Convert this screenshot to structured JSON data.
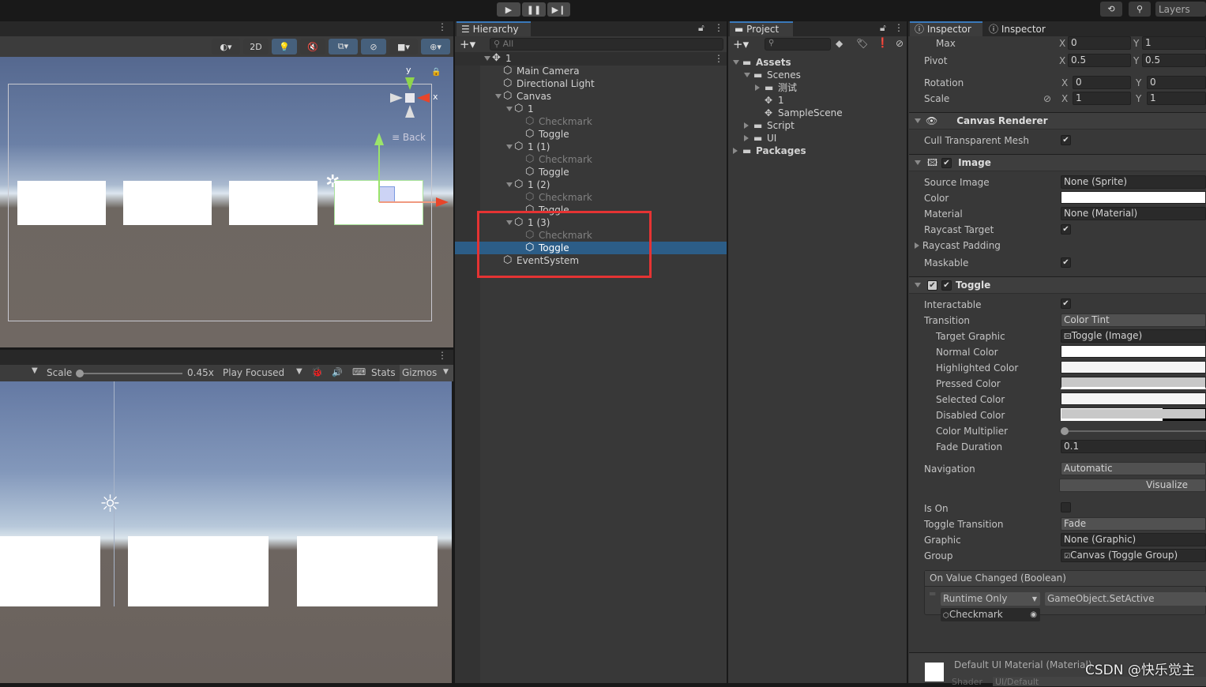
{
  "toolbar": {
    "play_icon": "play-icon",
    "pause_icon": "pause-icon",
    "step_icon": "step-icon",
    "layers": "Layers"
  },
  "scene": {
    "mode_2d": "2D",
    "gizmo_y": "y",
    "gizmo_x": "x",
    "view_label": "Back"
  },
  "game": {
    "scale_label": "Scale",
    "scale_value": "0.45x",
    "scale_fraction": 0.0,
    "play_mode": "Play Focused",
    "stats": "Stats",
    "gizmos": "Gizmos"
  },
  "hierarchy": {
    "title": "Hierarchy",
    "search_placeholder": "All",
    "rows": [
      {
        "text": "1",
        "depth": 0,
        "expanded": true,
        "scene": true
      },
      {
        "text": "Main Camera",
        "depth": 1
      },
      {
        "text": "Directional Light",
        "depth": 1
      },
      {
        "text": "Canvas",
        "depth": 1,
        "expanded": true
      },
      {
        "text": "1",
        "depth": 2,
        "expanded": true
      },
      {
        "text": "Checkmark",
        "depth": 3,
        "dim": true
      },
      {
        "text": "Toggle",
        "depth": 3
      },
      {
        "text": "1 (1)",
        "depth": 2,
        "expanded": true
      },
      {
        "text": "Checkmark",
        "depth": 3,
        "dim": true
      },
      {
        "text": "Toggle",
        "depth": 3
      },
      {
        "text": "1 (2)",
        "depth": 2,
        "expanded": true
      },
      {
        "text": "Checkmark",
        "depth": 3,
        "dim": true
      },
      {
        "text": "Toggle",
        "depth": 3
      },
      {
        "text": "1 (3)",
        "depth": 2,
        "expanded": true
      },
      {
        "text": "Checkmark",
        "depth": 3,
        "dim": true
      },
      {
        "text": "Toggle",
        "depth": 3,
        "selected": true
      },
      {
        "text": "EventSystem",
        "depth": 1
      }
    ]
  },
  "project": {
    "title": "Project",
    "rows": [
      {
        "text": "Assets",
        "depth": 0,
        "arrow": "down",
        "icon": "folder-open",
        "bold": true
      },
      {
        "text": "Scenes",
        "depth": 1,
        "arrow": "down",
        "icon": "folder-open"
      },
      {
        "text": "测试",
        "depth": 2,
        "arrow": "right",
        "icon": "folder"
      },
      {
        "text": "1",
        "depth": 2,
        "icon": "unity-scene"
      },
      {
        "text": "SampleScene",
        "depth": 2,
        "icon": "unity-scene"
      },
      {
        "text": "Script",
        "depth": 1,
        "arrow": "right",
        "icon": "folder"
      },
      {
        "text": "UI",
        "depth": 1,
        "arrow": "right",
        "icon": "folder"
      },
      {
        "text": "Packages",
        "depth": 0,
        "arrow": "right",
        "icon": "folder",
        "bold": true
      }
    ]
  },
  "inspector": {
    "tab1": "Inspector",
    "tab2": "Inspector",
    "max": {
      "label": "Max",
      "x": "0",
      "y": "1"
    },
    "pivot": {
      "label": "Pivot",
      "x": "0.5",
      "y": "0.5"
    },
    "rotation": {
      "label": "Rotation",
      "x": "0",
      "y": "0"
    },
    "scale": {
      "label": "Scale",
      "x": "1",
      "y": "1"
    },
    "canvas_renderer": {
      "title": "Canvas Renderer",
      "cull": "Cull Transparent Mesh",
      "cull_checked": true
    },
    "image": {
      "title": "Image",
      "source_image": "Source Image",
      "source_value": "None (Sprite)",
      "color": "Color",
      "color_value": "#ffffff",
      "material": "Material",
      "material_value": "None (Material)",
      "raycast_target": "Raycast Target",
      "raycast_padding": "Raycast Padding",
      "maskable": "Maskable"
    },
    "toggle": {
      "title": "Toggle",
      "interactable": "Interactable",
      "transition": "Transition",
      "transition_value": "Color Tint",
      "target_graphic": "Target Graphic",
      "target_graphic_value": "Toggle (Image)",
      "normal": "Normal Color",
      "normal_color": "#ffffff",
      "highlighted": "Highlighted Color",
      "highlighted_color": "#f5f5f5",
      "pressed": "Pressed Color",
      "pressed_color": "#c8c8c8",
      "selected": "Selected Color",
      "selected_color": "#f5f5f5",
      "disabled": "Disabled Color",
      "disabled_color": "#c8c8c8",
      "multiplier": "Color Multiplier",
      "multiplier_value": 1,
      "fade": "Fade Duration",
      "fade_value": "0.1",
      "navigation": "Navigation",
      "navigation_value": "Automatic",
      "visualize": "Visualize",
      "is_on": "Is On",
      "is_on_checked": false,
      "toggle_transition": "Toggle Transition",
      "toggle_transition_value": "Fade",
      "graphic": "Graphic",
      "graphic_value": "None (Graphic)",
      "group": "Group",
      "group_value": "Canvas (Toggle Group)",
      "event_title": "On Value Changed (Boolean)",
      "runtime": "Runtime Only",
      "function": "GameObject.SetActive",
      "target": "Checkmark"
    },
    "material": {
      "name": "Default UI Material (Material)",
      "shader_label": "Shader",
      "shader_value": "UI/Default"
    }
  },
  "watermark": "CSDN @快乐觉主",
  "colors": {
    "selection": "#2c5d87",
    "highlight_box": "#e53333",
    "accent": "#3a79bb"
  }
}
